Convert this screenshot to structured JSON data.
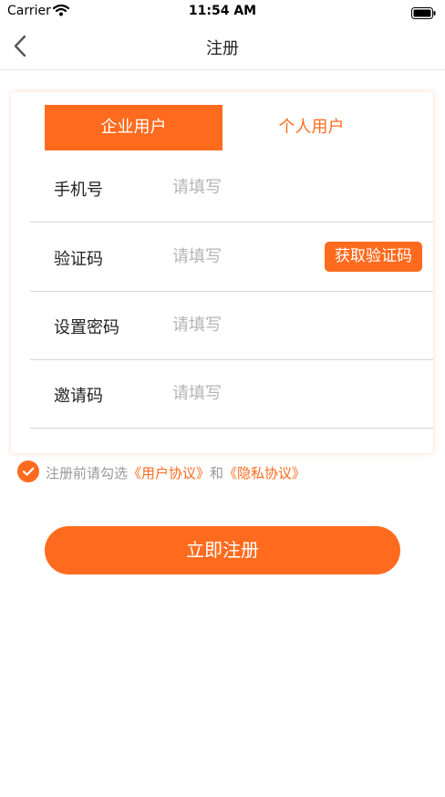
{
  "status_bar": {
    "carrier": "Carrier",
    "time": "11:54 AM"
  },
  "nav": {
    "title": "注册",
    "back_icon": "chevron-left-icon"
  },
  "tabs": [
    {
      "label": "企业用户",
      "active": true
    },
    {
      "label": "个人用户",
      "active": false
    }
  ],
  "form": {
    "rows": [
      {
        "label": "手机号",
        "placeholder": "请填写",
        "value": ""
      },
      {
        "label": "验证码",
        "placeholder": "请填写",
        "value": "",
        "action": "获取验证码"
      },
      {
        "label": "设置密码",
        "placeholder": "请填写",
        "value": ""
      },
      {
        "label": "邀请码",
        "placeholder": "请填写",
        "value": ""
      }
    ]
  },
  "agreement": {
    "checked": true,
    "prefix": "注册前请勾选",
    "user_agreement": "《用户协议》",
    "and": "和",
    "privacy_agreement": "《隐私协议》"
  },
  "submit_label": "立即注册",
  "colors": {
    "accent": "#ff6b1e",
    "placeholder": "#b4b4b4",
    "muted_text": "#999999",
    "divider": "#d6d6d6"
  }
}
